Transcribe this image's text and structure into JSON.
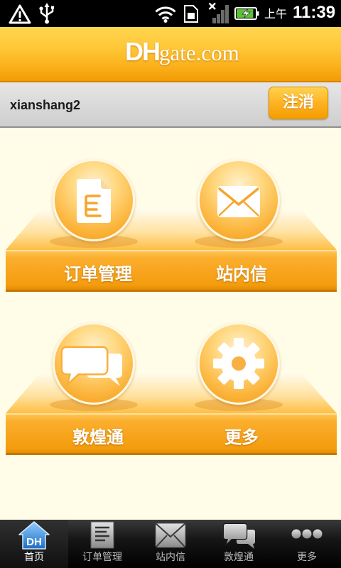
{
  "status_bar": {
    "ampm": "上午",
    "time": "11:39",
    "battery_level": 0.9,
    "signal_level": 0,
    "wifi_level": 3,
    "icons": [
      "warning-icon",
      "usb-icon",
      "wifi-icon",
      "sim-card-icon",
      "no-signal-icon",
      "battery-charging-icon"
    ]
  },
  "header": {
    "logo_dh": "DH",
    "logo_rest": "gate.com"
  },
  "user_bar": {
    "username": "xianshang2",
    "logout_label": "注消"
  },
  "menu": {
    "items": [
      {
        "label": "订单管理",
        "icon": "document-icon"
      },
      {
        "label": "站内信",
        "icon": "envelope-icon"
      },
      {
        "label": "敦煌通",
        "icon": "chat-bubbles-icon"
      },
      {
        "label": "更多",
        "icon": "gear-icon"
      }
    ]
  },
  "tab_bar": {
    "home_icon_text": "DH",
    "tabs": [
      {
        "label": "首页",
        "icon": "home-icon",
        "active": true
      },
      {
        "label": "订单管理",
        "icon": "document-icon",
        "active": false
      },
      {
        "label": "站内信",
        "icon": "envelope-icon",
        "active": false
      },
      {
        "label": "敦煌通",
        "icon": "chat-bubbles-icon",
        "active": false
      },
      {
        "label": "更多",
        "icon": "more-dots-icon",
        "active": false
      }
    ]
  },
  "colors": {
    "accent": "#F7A000",
    "header": "#FDB827",
    "background": "#FFFDE8",
    "tab_active_icon": "#2E86D6"
  }
}
